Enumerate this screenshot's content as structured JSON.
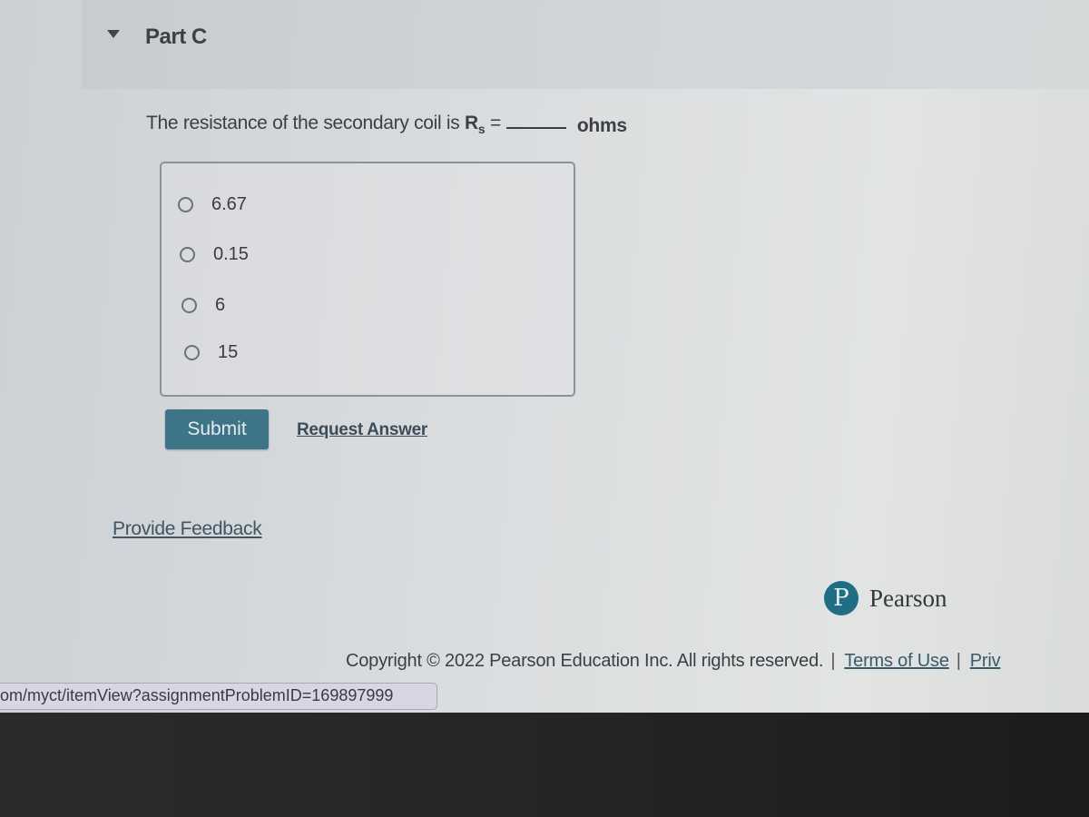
{
  "part": {
    "title": "Part C",
    "toggle_icon": "triangle-down-icon"
  },
  "question": {
    "prefix": "The resistance of the secondary coil is ",
    "variable": "R",
    "subscript": "s",
    "equals": "=",
    "unit": "ohms"
  },
  "options": [
    {
      "label": "6.67",
      "selected": false
    },
    {
      "label": "0.15",
      "selected": false
    },
    {
      "label": "6",
      "selected": false
    },
    {
      "label": "15",
      "selected": false
    }
  ],
  "actions": {
    "submit_label": "Submit",
    "request_answer_label": "Request Answer"
  },
  "feedback_label": "Provide Feedback",
  "brand": {
    "logo_letter": "P",
    "name": "Pearson",
    "color": "#1f6e83"
  },
  "footer": {
    "copyright": "Copyright © 2022 Pearson Education Inc. All rights reserved.",
    "separator": "|",
    "terms_label": "Terms of Use",
    "privacy_label_truncated": "Priv"
  },
  "status_bar": {
    "url": "om/myct/itemView?assignmentProblemID=169897999"
  },
  "colors": {
    "submit_bg": "#3e7488",
    "link": "#3b4c5a"
  }
}
